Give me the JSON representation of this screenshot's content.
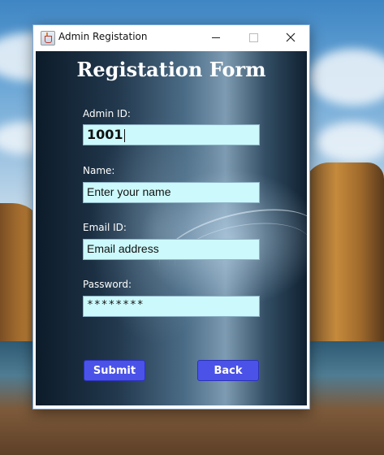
{
  "window": {
    "title": "Admin Registation"
  },
  "form": {
    "heading": "Registation Form",
    "admin_id": {
      "label": "Admin ID:",
      "value": "1001"
    },
    "name": {
      "label": "Name:",
      "value": "Enter your name"
    },
    "email": {
      "label": "Email ID:",
      "value": "Email address"
    },
    "password": {
      "label": "Password:",
      "value": "********"
    },
    "submit_label": "Submit",
    "back_label": "Back"
  },
  "colors": {
    "field_background": "#ccf9fb",
    "button_background": "#4a52e8"
  },
  "icons": {
    "app": "java-cup-icon",
    "minimize": "minimize-icon",
    "maximize": "maximize-icon",
    "close": "close-icon"
  }
}
